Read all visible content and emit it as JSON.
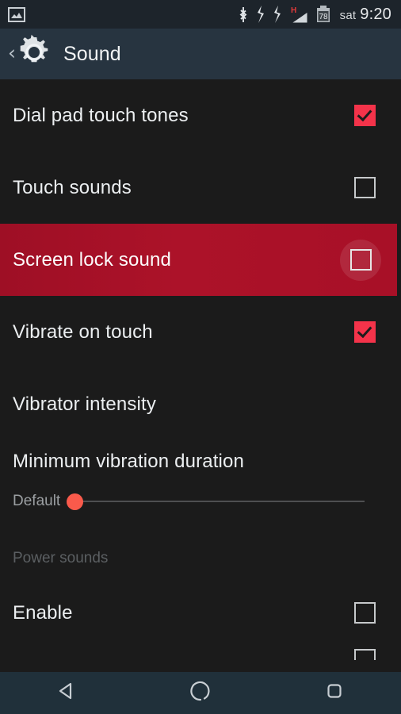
{
  "status_bar": {
    "notification_icons": [
      "screenshot-image-icon"
    ],
    "system_icons": [
      "bluetooth-icon",
      "vibrate-icon",
      "vibrate-icon-2",
      "signal-h-icon",
      "battery-icon"
    ],
    "signal_label": "H",
    "battery_level": "78",
    "day": "sat",
    "time": "9:20"
  },
  "action_bar": {
    "back_label": "‹",
    "app_icon": "gear-icon",
    "title": "Sound"
  },
  "settings": {
    "rows": [
      {
        "label": "Dial pad touch tones",
        "control": "checkbox",
        "checked": true,
        "highlighted": false
      },
      {
        "label": "Touch sounds",
        "control": "checkbox",
        "checked": false,
        "highlighted": false
      },
      {
        "label": "Screen lock sound",
        "control": "checkbox",
        "checked": false,
        "highlighted": true
      },
      {
        "label": "Vibrate on touch",
        "control": "checkbox",
        "checked": true,
        "highlighted": false
      },
      {
        "label": "Vibrator intensity",
        "control": "none",
        "checked": false,
        "highlighted": false
      },
      {
        "label": "Minimum vibration duration",
        "control": "none",
        "checked": false,
        "highlighted": false
      }
    ],
    "slider": {
      "label": "Default",
      "value_percent": 0
    },
    "section": {
      "header": "Power sounds",
      "rows": [
        {
          "label": "Enable",
          "control": "checkbox",
          "checked": false
        }
      ]
    }
  },
  "nav_bar": {
    "buttons": [
      {
        "name": "back-button",
        "icon": "back-triangle-icon"
      },
      {
        "name": "home-button",
        "icon": "home-circle-icon"
      },
      {
        "name": "recents-button",
        "icon": "recents-square-icon"
      }
    ]
  },
  "colors": {
    "accent_red": "#f4334a",
    "highlight_row": "#a81027",
    "slider_thumb": "#fa5a4b",
    "status_bar_bg": "#1d242b",
    "action_bar_bg": "#273440",
    "list_bg": "#1b1b1b",
    "nav_bar_bg": "#20303a"
  }
}
